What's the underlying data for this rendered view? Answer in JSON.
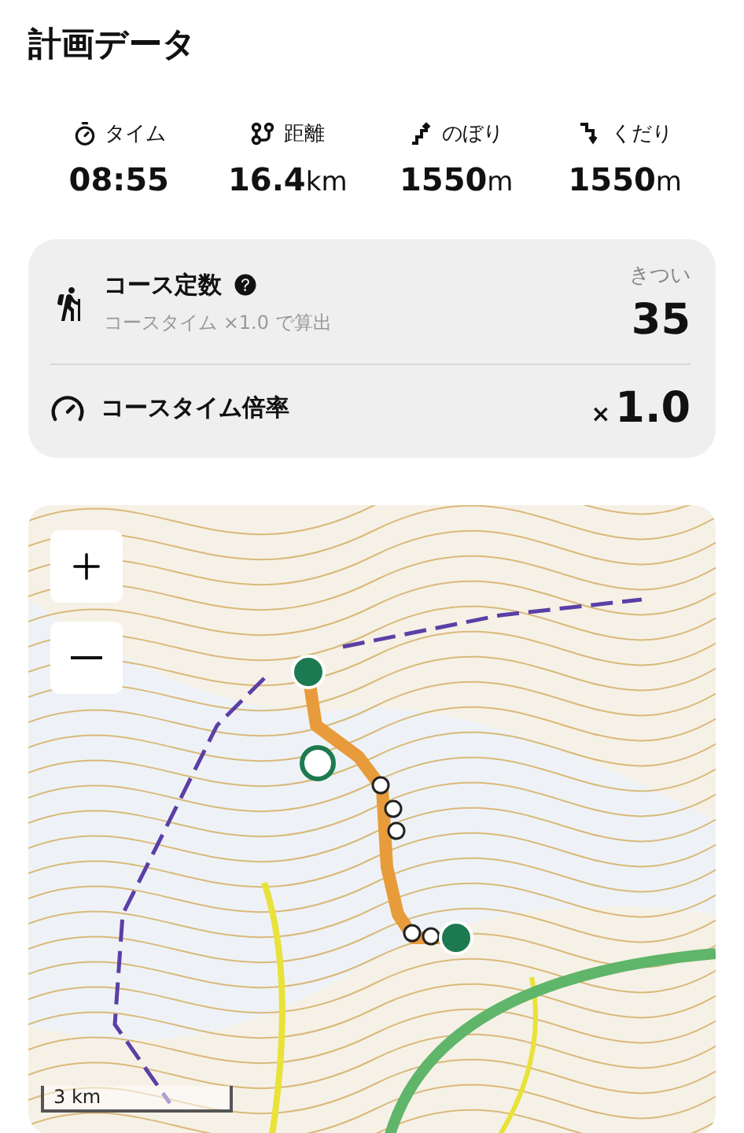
{
  "title": "計画データ",
  "stats": [
    {
      "kind": "time",
      "label": "タイム",
      "value": "08:55"
    },
    {
      "kind": "distance",
      "label": "距離",
      "value": "16.4",
      "unit": "km"
    },
    {
      "kind": "ascent",
      "label": "のぼり",
      "value": "1550",
      "unit": "m"
    },
    {
      "kind": "descent",
      "label": "くだり",
      "value": "1550",
      "unit": "m"
    }
  ],
  "course_constant": {
    "label": "コース定数",
    "note": "コースタイム ×1.0 で算出",
    "rating": "きつい",
    "value": "35"
  },
  "course_time_rate": {
    "label": "コースタイム倍率",
    "prefix": "×",
    "value": "1.0"
  },
  "map": {
    "scale": "3 km"
  }
}
